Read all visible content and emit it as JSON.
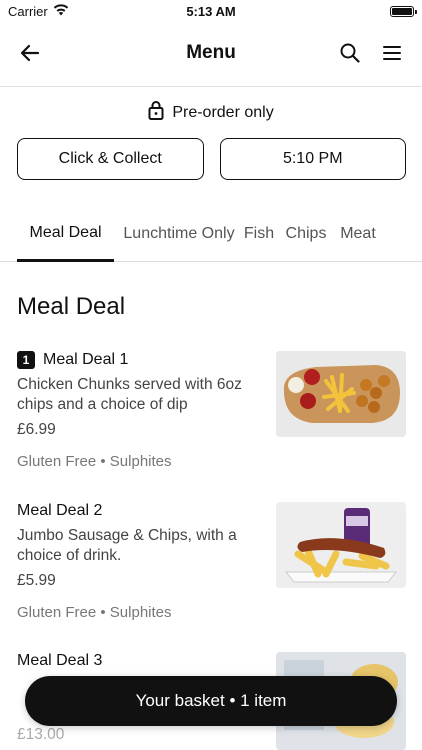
{
  "status_bar": {
    "carrier": "Carrier",
    "time": "5:13 AM"
  },
  "nav": {
    "title": "Menu"
  },
  "preorder": {
    "label": "Pre-order only"
  },
  "order_options": {
    "collect_label": "Click & Collect",
    "time_label": "5:10 PM"
  },
  "tabs": [
    {
      "label": "Meal Deal",
      "active": true
    },
    {
      "label": "Lunchtime Only",
      "active": false
    },
    {
      "label": "Fish",
      "active": false
    },
    {
      "label": "Chips",
      "active": false
    },
    {
      "label": "Meat",
      "active": false
    }
  ],
  "section": {
    "title": "Meal Deal"
  },
  "items": [
    {
      "qty": "1",
      "name": "Meal Deal 1",
      "description": "Chicken Chunks served with 6oz chips and a choice of dip",
      "price": "£6.99",
      "tags": "Gluten Free • Sulphites"
    },
    {
      "name": "Meal Deal 2",
      "description": "Jumbo Sausage & Chips, with a choice of drink.",
      "price": "£5.99",
      "tags": "Gluten Free • Sulphites"
    },
    {
      "name": "Meal Deal 3",
      "price": "£13.00"
    }
  ],
  "basket": {
    "label": "Your basket • 1 item"
  },
  "colors": {
    "primary": "#111111",
    "muted_text": "#777777",
    "divider": "#e2e2e2"
  }
}
